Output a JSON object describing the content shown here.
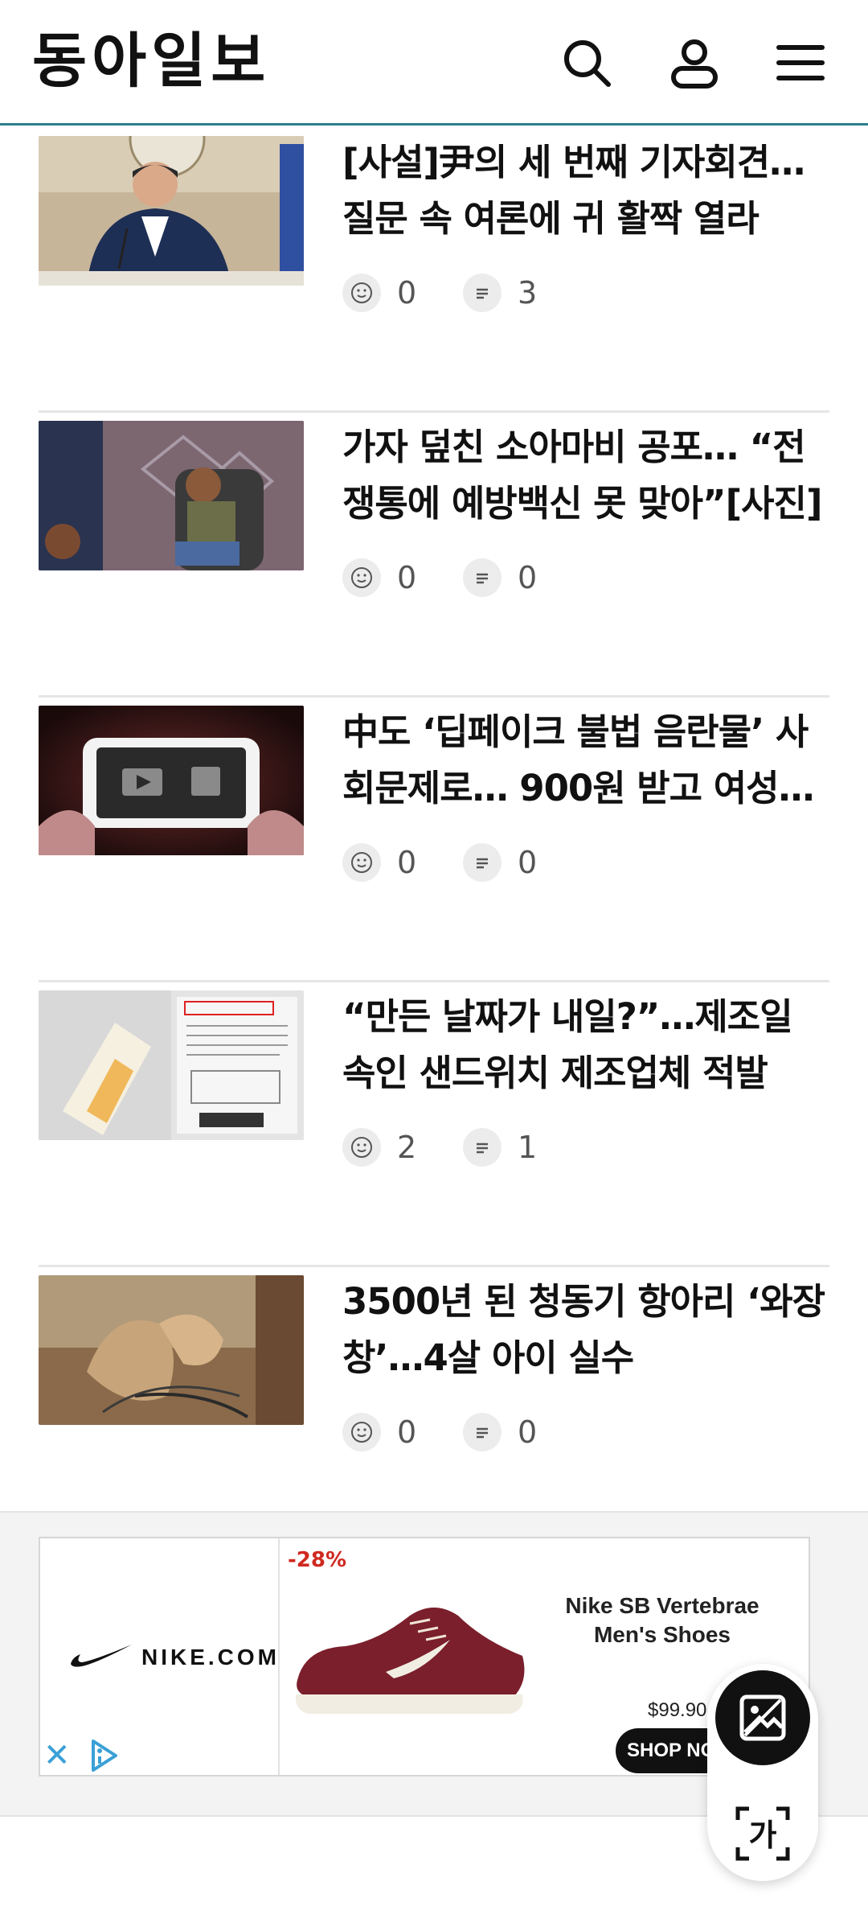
{
  "header": {
    "logo": "동아일보",
    "icons": [
      "search-icon",
      "user-icon",
      "menu-icon"
    ],
    "accent_color": "#2d7f8a"
  },
  "articles": [
    {
      "title": "[사설]尹의 세 번째 기자회견… 질문 속 여론에 귀 활짝 열라",
      "likes": "0",
      "comments": "3"
    },
    {
      "title": "가자 덮친 소아마비 공포… “전쟁통에 예방백신 못 맞아”[사진]",
      "likes": "0",
      "comments": "0"
    },
    {
      "title": "中도 ‘딥페이크 불법 음란물’ 사회문제로… 900원 받고 여성…",
      "likes": "0",
      "comments": "0"
    },
    {
      "title": "“만든 날짜가 내일?”…제조일 속인 샌드위치 제조업체 적발",
      "likes": "2",
      "comments": "1"
    },
    {
      "title": "3500년 된 청동기 항아리 ‘와장창’…4살 아이 실수",
      "likes": "0",
      "comments": "0"
    }
  ],
  "ad": {
    "brand": "NIKE.COM",
    "discount": "-28%",
    "product_name": "Nike SB Vertebrae Men's Shoes",
    "price": "$99.90",
    "cta": "SHOP NOW",
    "close_symbol": "✕",
    "shoe_color": "#7a1f2b"
  },
  "floating_tools": {
    "image_search": "image-icon",
    "text_translate": "text-scan-icon",
    "text_glyph": "가"
  }
}
